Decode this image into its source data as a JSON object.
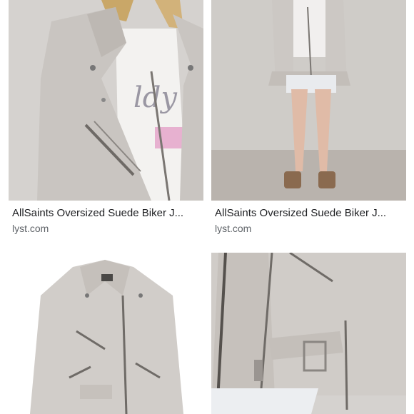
{
  "results": [
    {
      "title": "AllSaints Oversized Suede Biker J...",
      "source": "lyst.com",
      "image": "model-closeup-jacket-photo"
    },
    {
      "title": "AllSaints Oversized Suede Biker J...",
      "source": "lyst.com",
      "image": "model-full-length-jacket-photo"
    },
    {
      "title": "",
      "source": "",
      "image": "jacket-product-flatlay-photo"
    },
    {
      "title": "",
      "source": "",
      "image": "jacket-zipper-detail-photo"
    }
  ],
  "colors": {
    "title": "#202124",
    "source": "#5f6368",
    "suede": "#cfcac5",
    "background": "#ffffff"
  }
}
